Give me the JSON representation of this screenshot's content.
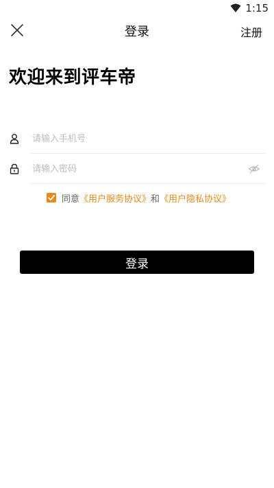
{
  "status_bar": {
    "time": "1:15",
    "wifi_icon": "wifi-icon"
  },
  "header": {
    "close_icon": "close-icon",
    "title": "登录",
    "register_label": "注册"
  },
  "welcome_text": "欢迎来到评车帝",
  "form": {
    "phone": {
      "icon": "user-icon",
      "placeholder": "请输入手机号",
      "value": ""
    },
    "password": {
      "icon": "lock-icon",
      "placeholder": "请输入密码",
      "value": "",
      "toggle_icon": "eye-hidden-icon"
    }
  },
  "agreement": {
    "checked": true,
    "accent_color": "#e8891c",
    "prefix": "同意",
    "terms_link": "《用户服务协议》",
    "conjunction": "和",
    "privacy_link": "《用户隐私协议》"
  },
  "login_button_label": "登录"
}
